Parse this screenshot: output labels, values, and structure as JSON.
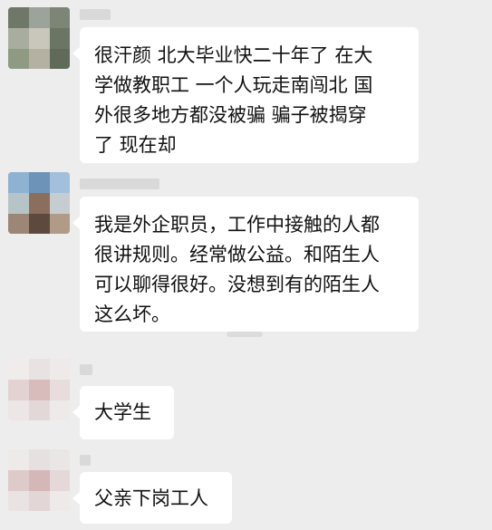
{
  "chat": {
    "messages": [
      {
        "text": "很汗颜 北大毕业快二十年了 在大\n学做教职工 一个人玩走南闯北 国\n外很多地方都没被骗 骗子被揭穿\n了 现在却"
      },
      {
        "text": "我是外企职员，工作中接触的人都\n很讲规则。经常做公益。和陌生人\n可以聊得很好。没想到有的陌生人\n这么坏。"
      },
      {
        "text": "大学生"
      },
      {
        "text": "父亲下岗工人"
      }
    ]
  },
  "colors": {
    "background": "#ededed",
    "bubble": "#ffffff",
    "text": "#111111",
    "blurred_name": "#d9d9d9"
  },
  "icons": [
    "avatar-image",
    "avatar-image",
    "avatar-image",
    "avatar-image"
  ]
}
